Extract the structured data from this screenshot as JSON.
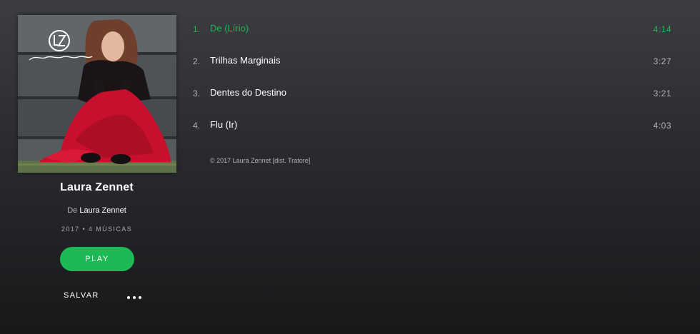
{
  "album": {
    "cover_label": "Laura Zennet",
    "title": "Laura Zennet",
    "by_prefix": "De",
    "artist": "Laura Zennet",
    "meta": "2017 • 4 MÚSICAS"
  },
  "actions": {
    "play_label": "PLAY",
    "save_label": "SALVAR",
    "more_icon": "more-horizontal-icon"
  },
  "tracks": [
    {
      "number": "1.",
      "title": "De (Lírio)",
      "duration": "4:14",
      "active": true
    },
    {
      "number": "2.",
      "title": "Trilhas Marginais",
      "duration": "3:27",
      "active": false
    },
    {
      "number": "3.",
      "title": "Dentes do Destino",
      "duration": "3:21",
      "active": false
    },
    {
      "number": "4.",
      "title": "Flu (Ir)",
      "duration": "4:03",
      "active": false
    }
  ],
  "copyright": "© 2017 Laura Zennet [dist. Tratore]",
  "colors": {
    "accent": "#1db954",
    "text": "#ffffff",
    "muted": "#b3b3b3"
  }
}
